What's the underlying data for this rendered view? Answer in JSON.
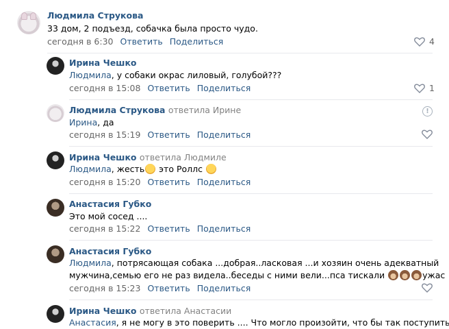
{
  "comments": [
    {
      "author": "Людмила Струкова",
      "reply_to": "",
      "text": "33 дом, 2 подъезд, собачка была просто чудо.",
      "time": "сегодня в 6:30",
      "reply_label": "Ответить",
      "share_label": "Поделиться",
      "likes": "4"
    },
    {
      "author": "Ирина Чешко",
      "reply_to": "",
      "mention": "Людмила",
      "text": ", у собаки окрас лиловый, голубой???",
      "time": "сегодня в 15:08",
      "reply_label": "Ответить",
      "share_label": "Поделиться",
      "likes": "1"
    },
    {
      "author": "Людмила Струкова",
      "reply_to": "ответила Ирине",
      "mention": "Ирина",
      "text": ", да",
      "time": "сегодня в 15:19",
      "reply_label": "Ответить",
      "share_label": "Поделиться",
      "likes": ""
    },
    {
      "author": "Ирина Чешко",
      "reply_to": "ответила Людмиле",
      "mention": "Людмила",
      "text_a": ", жесть",
      "text_b": " это Роллс ",
      "time": "сегодня в 15:20",
      "reply_label": "Ответить",
      "share_label": "Поделиться",
      "likes": ""
    },
    {
      "author": "Анастасия Губко",
      "reply_to": "",
      "text": "Это мой сосед ....",
      "time": "сегодня в 15:22",
      "reply_label": "Ответить",
      "share_label": "Поделиться",
      "likes": ""
    },
    {
      "author": "Анастасия Губко",
      "reply_to": "",
      "mention": "Людмила",
      "text_line1": ", потрясающая собака ...добрая..ласковая ...и хозяин очень адекватный",
      "text_line2": "мужчина,семью его не раз видела..беседы с ними вели...пса тискали ",
      "text_tail": "ужас",
      "time": "сегодня в 15:23",
      "reply_label": "Ответить",
      "share_label": "Поделиться",
      "likes": ""
    },
    {
      "author": "Ирина Чешко",
      "reply_to": "ответила Анастасии",
      "mention": "Анастасия",
      "text": ", я не могу в это поверить .... Что могло произойти, что бы так поступить"
    }
  ]
}
